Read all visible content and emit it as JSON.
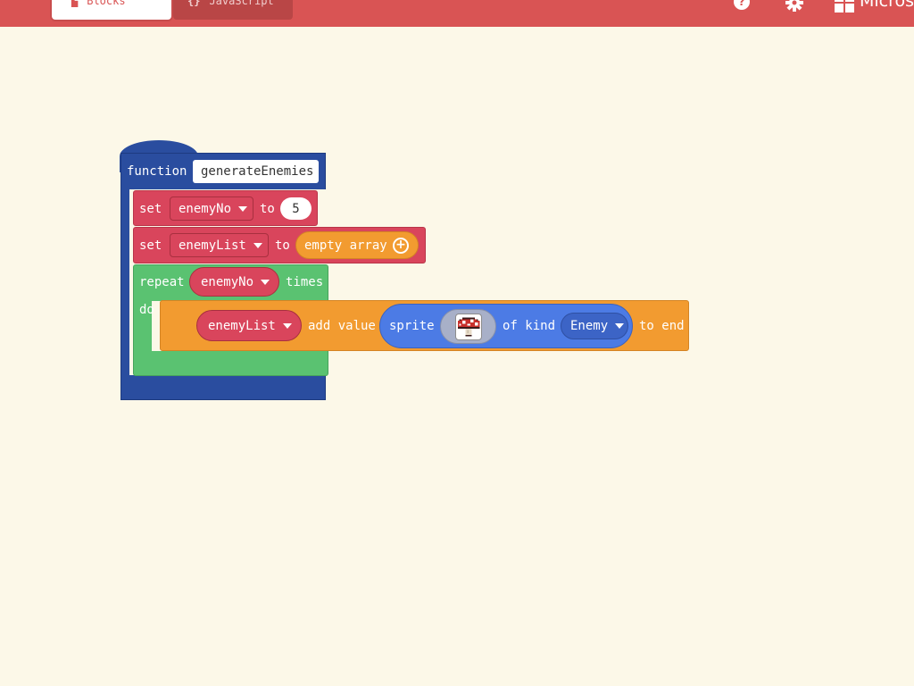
{
  "toolbar": {
    "tabs": [
      {
        "label": "Blocks",
        "icon": "blocks-icon",
        "active": true
      },
      {
        "label": "JavaScript",
        "icon": "code-braces-icon",
        "active": false
      }
    ],
    "help_icon": "help-icon",
    "settings_icon": "gear-icon",
    "brand": "Micros"
  },
  "colors": {
    "toolbar": "#d95454",
    "canvas": "#fcf8e8",
    "function_block": "#2a4d9f",
    "variables_block": "#d9455c",
    "array_block": "#f29b30",
    "loops_block": "#5ac271",
    "sprites_block": "#4c7be5"
  },
  "workspace": {
    "function_block": {
      "keyword": "function",
      "name": "generateEnemies"
    },
    "set_block_1": {
      "keyword": "set",
      "variable": "enemyNo",
      "to_label": "to",
      "value": "5"
    },
    "set_block_2": {
      "keyword": "set",
      "variable": "enemyList",
      "to_label": "to",
      "value": "empty array"
    },
    "repeat_block": {
      "keyword": "repeat",
      "variable": "enemyNo",
      "times_label": "times",
      "do_label": "do"
    },
    "add_block": {
      "variable": "enemyList",
      "add_label": "add value",
      "sprite_label": "sprite",
      "sprite_image": "mushroom-sprite",
      "kind_label": "of kind",
      "kind_value": "Enemy",
      "end_label": "to end"
    }
  }
}
